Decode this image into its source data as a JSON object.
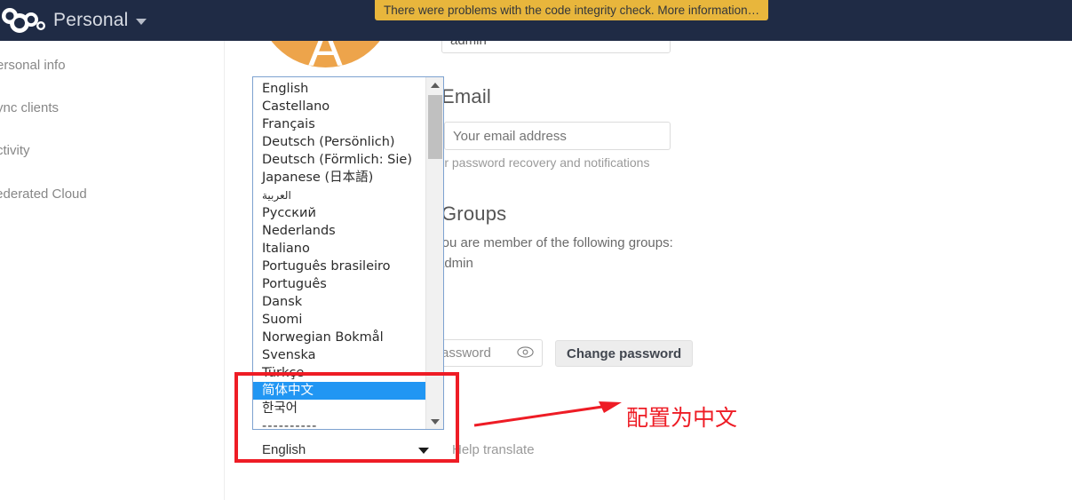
{
  "header": {
    "title": "Personal",
    "logo_icon": "nextcloud-logo-icon",
    "caret_icon": "chevron-down-icon"
  },
  "warning": {
    "message": "There were problems with the code integrity check. More information…"
  },
  "sidebar": {
    "items": [
      {
        "label": "Personal info"
      },
      {
        "label": "Sync clients"
      },
      {
        "label": "Activity"
      },
      {
        "label": "Federated Cloud"
      }
    ]
  },
  "avatar": {
    "letter": "A",
    "color": "#eda44b"
  },
  "form": {
    "username_value": "admin",
    "email_heading": "Email",
    "email_placeholder": "Your email address",
    "email_hint": "For password recovery and notifications",
    "groups_heading": "Groups",
    "groups_description": "You are member of the following groups:",
    "groups_value": "admin",
    "password_placeholder": "Password",
    "password_eye_icon": "eye-icon",
    "change_password_label": "Change password",
    "help_translate_label": "Help translate"
  },
  "language_select": {
    "selected_value": "English",
    "caret_icon": "chevron-down-icon",
    "highlighted_option": "简体中文",
    "scroll_up_icon": "scroll-up-arrow-icon",
    "scroll_down_icon": "scroll-down-arrow-icon",
    "options": [
      {
        "label": "English",
        "highlighted": false,
        "rtl": false
      },
      {
        "label": "Castellano",
        "highlighted": false,
        "rtl": false
      },
      {
        "label": "Français",
        "highlighted": false,
        "rtl": false
      },
      {
        "label": "Deutsch (Persönlich)",
        "highlighted": false,
        "rtl": false
      },
      {
        "label": "Deutsch (Förmlich: Sie)",
        "highlighted": false,
        "rtl": false
      },
      {
        "label": "Japanese (日本語)",
        "highlighted": false,
        "rtl": false
      },
      {
        "label": "العربية",
        "highlighted": false,
        "rtl": true
      },
      {
        "label": "Русский",
        "highlighted": false,
        "rtl": false
      },
      {
        "label": "Nederlands",
        "highlighted": false,
        "rtl": false
      },
      {
        "label": "Italiano",
        "highlighted": false,
        "rtl": false
      },
      {
        "label": "Português brasileiro",
        "highlighted": false,
        "rtl": false
      },
      {
        "label": "Português",
        "highlighted": false,
        "rtl": false
      },
      {
        "label": "Dansk",
        "highlighted": false,
        "rtl": false
      },
      {
        "label": "Suomi",
        "highlighted": false,
        "rtl": false
      },
      {
        "label": "Norwegian Bokmål",
        "highlighted": false,
        "rtl": false
      },
      {
        "label": "Svenska",
        "highlighted": false,
        "rtl": false
      },
      {
        "label": "Türkçe",
        "highlighted": false,
        "rtl": false
      },
      {
        "label": "简体中文",
        "highlighted": true,
        "rtl": false
      },
      {
        "label": "한국어",
        "highlighted": false,
        "rtl": false
      },
      {
        "label": "----------",
        "highlighted": false,
        "rtl": false
      }
    ]
  },
  "annotation": {
    "text": "配置为中文",
    "color": "#ee1c25"
  }
}
